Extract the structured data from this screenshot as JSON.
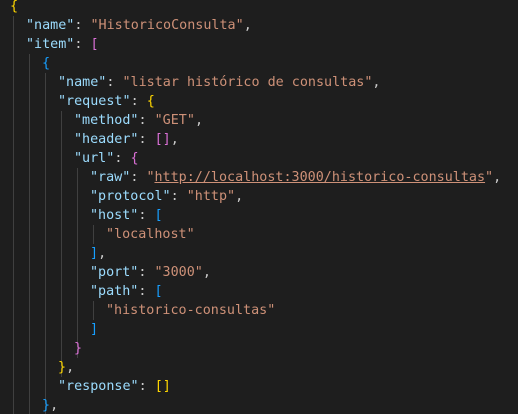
{
  "editor": {
    "language": "json",
    "colors": {
      "background": "#1e1e1e",
      "key": "#9cdcfe",
      "string": "#ce9178",
      "bracket_level1": "#ffd700",
      "bracket_level2": "#da70d6",
      "bracket_level3": "#179fff",
      "indent_guide": "#404040"
    },
    "lines": [
      {
        "tokens": [
          {
            "t": "{",
            "c": "b1"
          }
        ]
      },
      {
        "tokens": [
          {
            "t": "\"name\"",
            "c": "key"
          },
          {
            "t": ": ",
            "c": "punc"
          },
          {
            "t": "\"HistoricoConsulta\"",
            "c": "str"
          },
          {
            "t": ",",
            "c": "punc"
          }
        ]
      },
      {
        "tokens": [
          {
            "t": "\"item\"",
            "c": "key"
          },
          {
            "t": ": ",
            "c": "punc"
          },
          {
            "t": "[",
            "c": "b2"
          }
        ]
      },
      {
        "tokens": [
          {
            "t": "{",
            "c": "b3"
          }
        ]
      },
      {
        "tokens": [
          {
            "t": "\"name\"",
            "c": "key"
          },
          {
            "t": ": ",
            "c": "punc"
          },
          {
            "t": "\"listar histórico de consultas\"",
            "c": "str"
          },
          {
            "t": ",",
            "c": "punc"
          }
        ]
      },
      {
        "tokens": [
          {
            "t": "\"request\"",
            "c": "key"
          },
          {
            "t": ": ",
            "c": "punc"
          },
          {
            "t": "{",
            "c": "b1"
          }
        ]
      },
      {
        "tokens": [
          {
            "t": "\"method\"",
            "c": "key"
          },
          {
            "t": ": ",
            "c": "punc"
          },
          {
            "t": "\"GET\"",
            "c": "str"
          },
          {
            "t": ",",
            "c": "punc"
          }
        ]
      },
      {
        "tokens": [
          {
            "t": "\"header\"",
            "c": "key"
          },
          {
            "t": ": ",
            "c": "punc"
          },
          {
            "t": "[]",
            "c": "b2"
          },
          {
            "t": ",",
            "c": "punc"
          }
        ]
      },
      {
        "tokens": [
          {
            "t": "\"url\"",
            "c": "key"
          },
          {
            "t": ": ",
            "c": "punc"
          },
          {
            "t": "{",
            "c": "b2"
          }
        ]
      },
      {
        "tokens": [
          {
            "t": "\"raw\"",
            "c": "key"
          },
          {
            "t": ": ",
            "c": "punc"
          },
          {
            "t": "\"",
            "c": "str"
          },
          {
            "t": "http://localhost:3000/historico-consultas",
            "c": "url"
          },
          {
            "t": "\"",
            "c": "str"
          },
          {
            "t": ",",
            "c": "punc"
          }
        ]
      },
      {
        "tokens": [
          {
            "t": "\"protocol\"",
            "c": "key"
          },
          {
            "t": ": ",
            "c": "punc"
          },
          {
            "t": "\"http\"",
            "c": "str"
          },
          {
            "t": ",",
            "c": "punc"
          }
        ]
      },
      {
        "tokens": [
          {
            "t": "\"host\"",
            "c": "key"
          },
          {
            "t": ": ",
            "c": "punc"
          },
          {
            "t": "[",
            "c": "b3"
          }
        ]
      },
      {
        "tokens": [
          {
            "t": "\"localhost\"",
            "c": "str"
          }
        ]
      },
      {
        "tokens": [
          {
            "t": "]",
            "c": "b3"
          },
          {
            "t": ",",
            "c": "punc"
          }
        ]
      },
      {
        "tokens": [
          {
            "t": "\"port\"",
            "c": "key"
          },
          {
            "t": ": ",
            "c": "punc"
          },
          {
            "t": "\"3000\"",
            "c": "str"
          },
          {
            "t": ",",
            "c": "punc"
          }
        ]
      },
      {
        "tokens": [
          {
            "t": "\"path\"",
            "c": "key"
          },
          {
            "t": ": ",
            "c": "punc"
          },
          {
            "t": "[",
            "c": "b3"
          }
        ]
      },
      {
        "tokens": [
          {
            "t": "\"historico-consultas\"",
            "c": "str"
          }
        ]
      },
      {
        "tokens": [
          {
            "t": "]",
            "c": "b3"
          }
        ]
      },
      {
        "tokens": [
          {
            "t": "}",
            "c": "b2"
          }
        ]
      },
      {
        "tokens": [
          {
            "t": "}",
            "c": "b1"
          },
          {
            "t": ",",
            "c": "punc"
          }
        ]
      },
      {
        "tokens": [
          {
            "t": "\"response\"",
            "c": "key"
          },
          {
            "t": ": ",
            "c": "punc"
          },
          {
            "t": "[]",
            "c": "b1"
          }
        ]
      },
      {
        "tokens": [
          {
            "t": "}",
            "c": "b3"
          },
          {
            "t": ",",
            "c": "punc"
          }
        ]
      }
    ]
  }
}
